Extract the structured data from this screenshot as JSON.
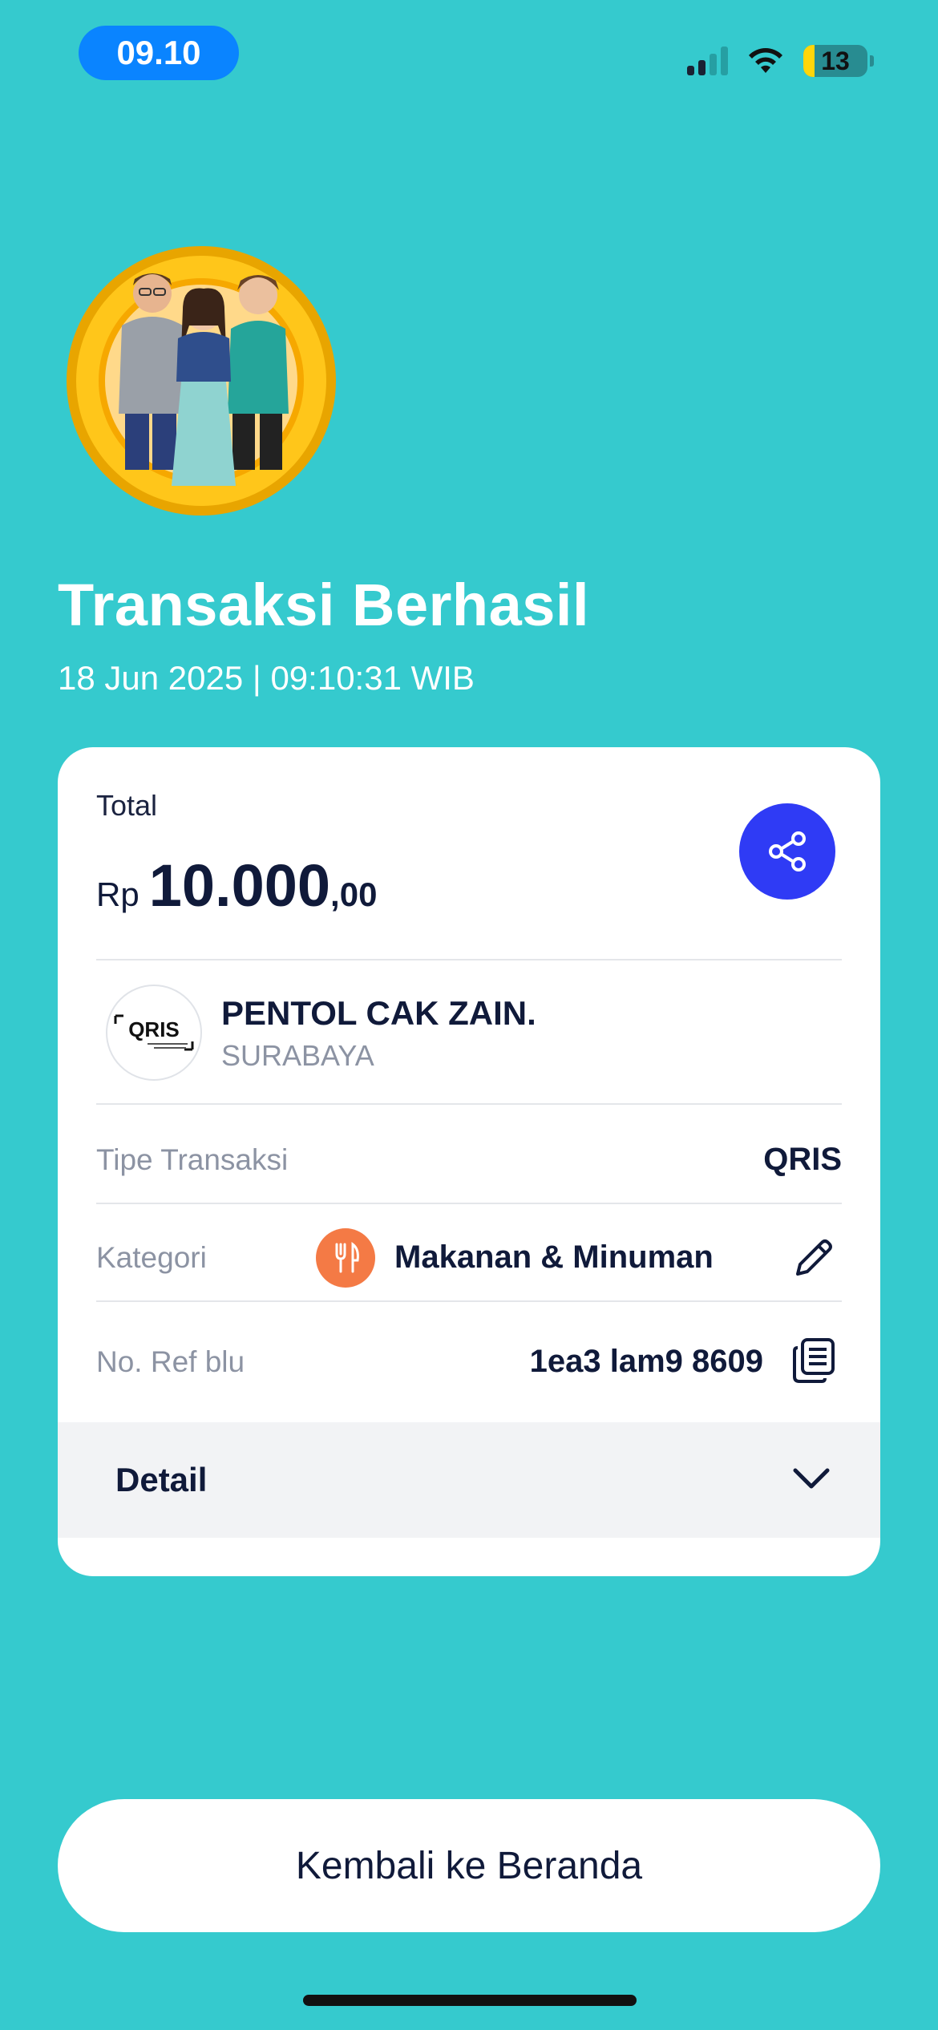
{
  "status_bar": {
    "time": "09.10",
    "battery": "13"
  },
  "header": {
    "title": "Transaksi Berhasil",
    "datetime": "18 Jun 2025 | 09:10:31 WIB"
  },
  "card": {
    "total_label": "Total",
    "currency": "Rp",
    "amount_main": "10.000",
    "amount_cents": ",00",
    "merchant": {
      "name": "PENTOL CAK ZAIN.",
      "city": "SURABAYA",
      "logo_text": "QRIS"
    },
    "rows": [
      {
        "label": "Tipe Transaksi",
        "value": "QRIS"
      },
      {
        "label": "Kategori",
        "value": "Makanan & Minuman",
        "icon": "fork-knife-icon"
      },
      {
        "label": "No. Ref blu",
        "value": "1ea3 lam9 8609"
      }
    ],
    "detail_label": "Detail"
  },
  "footer": {
    "home_button": "Kembali ke Beranda"
  },
  "colors": {
    "background": "#35CACE",
    "accent": "#2F3BF5",
    "category": "#F47A45",
    "time_pill": "#0A84FF"
  }
}
